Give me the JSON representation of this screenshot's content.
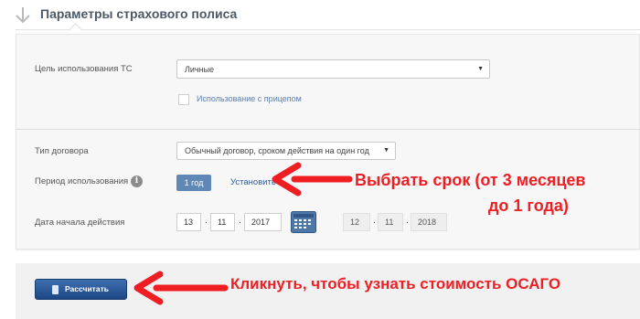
{
  "header": {
    "title": "Параметры страхового полиса"
  },
  "form": {
    "vehicle_use": {
      "label": "Цель использования ТС",
      "value": "Личные"
    },
    "trailer": {
      "label": "Использование с прицепом",
      "checked": false
    },
    "contract_type": {
      "label": "Тип договора",
      "value": "Обычный договор, сроком действия на один год"
    },
    "usage_period": {
      "label": "Период использования",
      "value": "1 год",
      "set_link": "Установить"
    },
    "start_date": {
      "label": "Дата начала действия",
      "day": "13",
      "month": "11",
      "year": "2017",
      "end_day": "12",
      "end_month": "11",
      "end_year": "2018",
      "separator": "."
    }
  },
  "actions": {
    "calculate_label": "Рассчитать"
  },
  "annotations": {
    "period_note_line1": "Выбрать срок (от 3 месяцев",
    "period_note_line2": "до 1 года)",
    "calc_note": "Кликнуть, чтобы узнать стоимость ОСАГО"
  },
  "colors": {
    "annotation": "#ee1e23",
    "accent": "#5f88b6",
    "button": "#1b4683"
  },
  "icons": {
    "section": "down-arrow-icon",
    "info": "info-icon",
    "calendar": "calendar-icon",
    "calculator": "calculator-icon"
  }
}
